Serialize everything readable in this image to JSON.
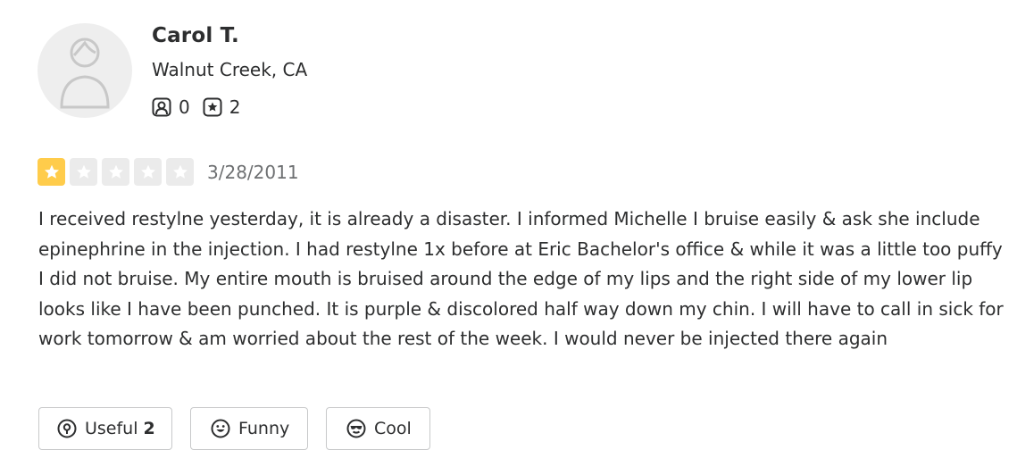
{
  "reviewer": {
    "name": "Carol T.",
    "location": "Walnut Creek, CA",
    "stats": [
      {
        "icon": "friends-icon",
        "value": "0"
      },
      {
        "icon": "reviews-star-icon",
        "value": "2"
      }
    ]
  },
  "review": {
    "rating": 1,
    "rating_max": 5,
    "star_color": "#ffcc4b",
    "date": "3/28/2011",
    "text": "I received restylne yesterday, it is already a disaster. I informed Michelle I bruise easily & ask she include epinephrine in the injection. I had restylne 1x before at Eric Bachelor's office & while it was a little too puffy I did not bruise. My entire mouth is bruised around the edge of my lips and the right side of my lower lip looks like I have been punched. It is purple & discolored half way down my chin. I will have to call in sick for work tomorrow & am worried about the rest of the week. I would never be injected there again"
  },
  "actions": {
    "useful_label": "Useful",
    "useful_count": "2",
    "funny_label": "Funny",
    "cool_label": "Cool"
  }
}
